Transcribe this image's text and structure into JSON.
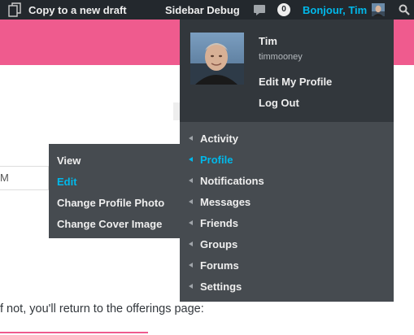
{
  "adminbar": {
    "copy_label": "Copy to a new draft",
    "debug_label": "Sidebar Debug",
    "comment_count": "0",
    "greeting": "Bonjour, Tim"
  },
  "page": {
    "input_value": "M",
    "body_text": "f not, you'll return to the offerings page:"
  },
  "account": {
    "display_name": "Tim",
    "username": "timmooney",
    "edit_profile": "Edit My Profile",
    "logout": "Log Out"
  },
  "bp_menu": {
    "items": [
      {
        "label": "Activity"
      },
      {
        "label": "Profile"
      },
      {
        "label": "Notifications"
      },
      {
        "label": "Messages"
      },
      {
        "label": "Friends"
      },
      {
        "label": "Groups"
      },
      {
        "label": "Forums"
      },
      {
        "label": "Settings"
      }
    ],
    "active_index": 1
  },
  "profile_submenu": {
    "items": [
      {
        "label": "View"
      },
      {
        "label": "Edit"
      },
      {
        "label": "Change Profile Photo"
      },
      {
        "label": "Change Cover Image"
      }
    ],
    "active_index": 1
  },
  "colors": {
    "adminbar_bg": "#23282d",
    "accent": "#00b9eb",
    "brand_pink": "#ef5b8e",
    "menu_bg": "#464b50",
    "account_bg": "#32373c"
  },
  "icons": {
    "copy": "copy-icon",
    "comments": "comment-bubble-icon",
    "search": "search-icon",
    "menu_arrow": "triangle-left-icon"
  }
}
